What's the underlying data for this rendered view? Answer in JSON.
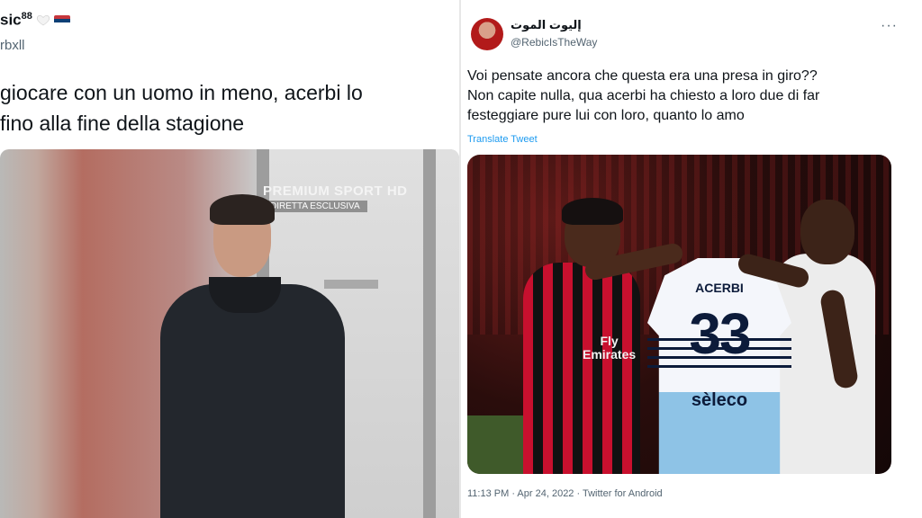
{
  "left_tweet": {
    "name": "sic",
    "name_sup": "88",
    "handle": "rbxll",
    "text": "giocare con un uomo in meno, acerbi lo\nfino alla fine della stagione",
    "watermark": "PREMIUM SPORT HD",
    "watermark_sub": "DIRETTA ESCLUSIVA"
  },
  "right_tweet": {
    "display_name": "إليوت الموت",
    "handle": "@RebicIsTheWay",
    "more": "···",
    "text": "Voi pensate ancora che questa era una presa in giro??\nNon capite nulla, qua acerbi ha chiesto a loro due di far\nfesteggiare pure lui con loro, quanto lo amo",
    "translate": "Translate Tweet",
    "shirt_name": "ACERBI",
    "shirt_number": "33",
    "shirt_brand": "sèleco",
    "sponsor": "Fly\nEmirates",
    "meta": "11:13 PM · Apr 24, 2022 · Twitter for Android"
  },
  "colors": {
    "link": "#1d9bf0",
    "muted": "#536471",
    "text": "#0f1419"
  },
  "icons": [
    "white-heart-icon",
    "serbia-flag-icon",
    "more-options-icon"
  ]
}
